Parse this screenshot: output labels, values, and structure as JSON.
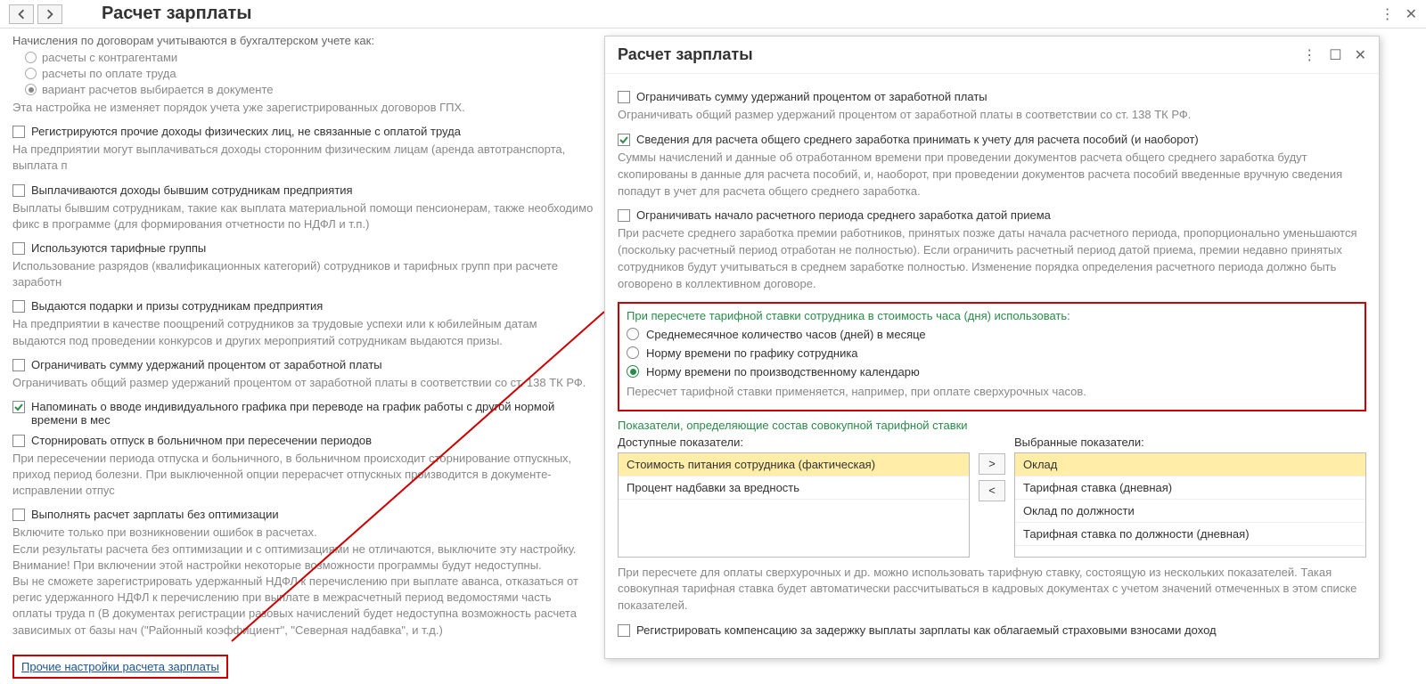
{
  "topbar": {
    "title": "Расчет зарплаты"
  },
  "left": {
    "accrual_label": "Начисления по договорам учитываются в бухгалтерском учете как:",
    "r1": "расчеты с контрагентами",
    "r2": "расчеты по оплате труда",
    "r3": "вариант расчетов выбирается в документе",
    "r3_desc": "Эта настройка не изменяет порядок учета уже зарегистрированных договоров ГПХ.",
    "c1": "Регистрируются прочие доходы физических лиц, не связанные с оплатой труда",
    "c1_desc": "На предприятии могут выплачиваться доходы сторонним физическим лицам (аренда автотранспорта, выплата п",
    "c2": "Выплачиваются доходы бывшим сотрудникам предприятия",
    "c2_desc": "Выплаты бывшим сотрудникам, такие как выплата материальной помощи пенсионерам, также необходимо фикс в программе (для формирования отчетности по НДФЛ и т.п.)",
    "c3": "Используются тарифные группы",
    "c3_desc": "Использование разрядов (квалификационных категорий) сотрудников и тарифных групп при расчете заработн",
    "c4": "Выдаются подарки и призы сотрудникам предприятия",
    "c4_desc": "На предприятии в качестве поощрений сотрудников за трудовые успехи или к юбилейным датам выдаются под проведении конкурсов и других мероприятий сотрудникам выдаются призы.",
    "c5": "Ограничивать сумму удержаний процентом от заработной платы",
    "c5_desc": "Ограничивать общий размер удержаний процентом от заработной платы в соответствии со ст. 138 ТК РФ.",
    "c6": "Напоминать о вводе индивидуального графика при переводе на график работы с другой нормой времени в мес",
    "c7": "Сторнировать отпуск в больничном при пересечении периодов",
    "c7_desc": "При пересечении периода отпуска и больничного, в больничном происходит сторнирование отпускных, приход период болезни. При выключенной опции перерасчет отпускных производится в документе-исправлении отпус",
    "c8": "Выполнять расчет зарплаты без оптимизации",
    "c8_desc": "Включите только при возникновении ошибок в расчетах.\nЕсли результаты расчета без оптимизации и с оптимизациями не отличаются, выключите эту настройку.\nВнимание! При включении этой настройки некоторые возможности программы будут недоступны.\nВы не сможете зарегистрировать удержанный НДФЛ к перечислению при выплате аванса, отказаться от регис удержанного НДФЛ к перечислению при выплате в межрасчетный период ведомостями часть оплаты труда п (В документах регистрации разовых начислений будет недоступна возможность расчета зависимых от базы нач (\"Районный коэффициент\", \"Северная надбавка\", и т.д.)",
    "link": "Прочие настройки расчета зарплаты"
  },
  "popup": {
    "title": "Расчет зарплаты",
    "p_c1": "Ограничивать сумму удержаний процентом от заработной платы",
    "p_c1_desc": "Ограничивать общий размер удержаний процентом от заработной платы в соответствии со ст. 138 ТК РФ.",
    "p_c2": "Сведения для расчета общего среднего заработка принимать к учету для расчета пособий (и наоборот)",
    "p_c2_desc": "Суммы начислений и данные об отработанном времени при проведении документов расчета общего среднего заработка будут скопированы в данные для расчета пособий, и, наоборот, при проведении документов расчета пособий введенные вручную сведения попадут в учет для расчета общего среднего заработка.",
    "p_c3": "Ограничивать начало расчетного периода среднего заработка датой приема",
    "p_c3_desc": "При расчете среднего заработка премии работников, принятых позже даты начала расчетного периода, пропорционально уменьшаются (поскольку расчетный период отработан не полностью). Если ограничить расчетный период датой приема, премии недавно принятых сотрудников будут учитываться в среднем заработке полностью. Изменение порядка определения расчетного периода должно быть оговорено в коллективном договоре.",
    "rate_title": "При пересчете тарифной ставки сотрудника в стоимость часа (дня) использовать:",
    "rr1": "Среднемесячное количество часов (дней) в месяце",
    "rr2": "Норму времени по графику сотрудника",
    "rr3": "Норму времени по производственному календарю",
    "rate_desc": "Пересчет тарифной ставки применяется, например, при оплате сверхурочных часов.",
    "ind_title": "Показатели, определяющие состав совокупной тарифной ставки",
    "avail_label": "Доступные показатели:",
    "sel_label": "Выбранные показатели:",
    "avail": [
      "Стоимость питания сотрудника (фактическая)",
      "Процент надбавки за вредность"
    ],
    "selected": [
      "Оклад",
      "Тарифная ставка (дневная)",
      "Оклад по должности",
      "Тарифная ставка по должности (дневная)"
    ],
    "ind_desc": "При пересчете для оплаты сверхурочных и др. можно использовать тарифную ставку, состоящую из нескольких показателей. Такая совокупная тарифная ставка будет автоматически рассчитываться в кадровых документах с учетом значений отмеченных в этом списке показателей.",
    "p_c4": "Регистрировать компенсацию за задержку выплаты зарплаты как облагаемый страховыми взносами доход",
    "move_r": ">",
    "move_l": "<"
  }
}
